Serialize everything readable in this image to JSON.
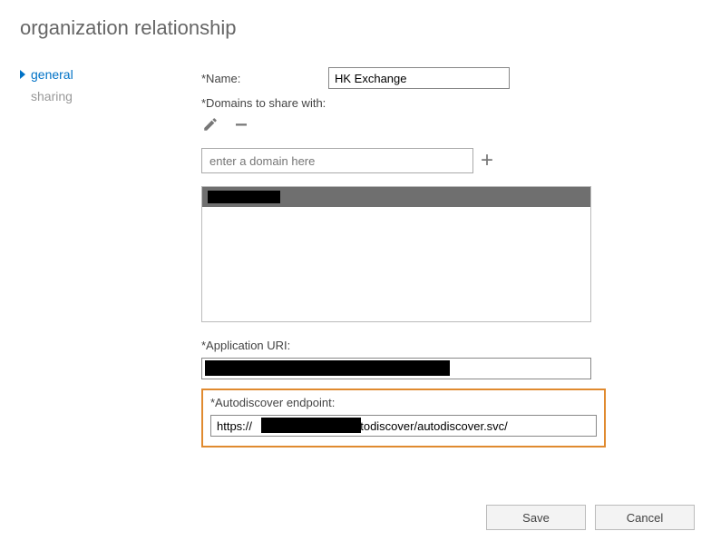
{
  "title": "organization relationship",
  "nav": {
    "general": "general",
    "sharing": "sharing"
  },
  "form": {
    "name_label": "*Name:",
    "name_value": "HK Exchange",
    "domains_label": "*Domains to share with:",
    "domain_placeholder": "enter a domain here",
    "app_uri_label": "*Application URI:",
    "app_uri_value": "",
    "autodiscover_label": "*Autodiscover endpoint:",
    "autodiscover_value": "https://                            /autodiscover/autodiscover.svc/"
  },
  "buttons": {
    "save": "Save",
    "cancel": "Cancel"
  }
}
